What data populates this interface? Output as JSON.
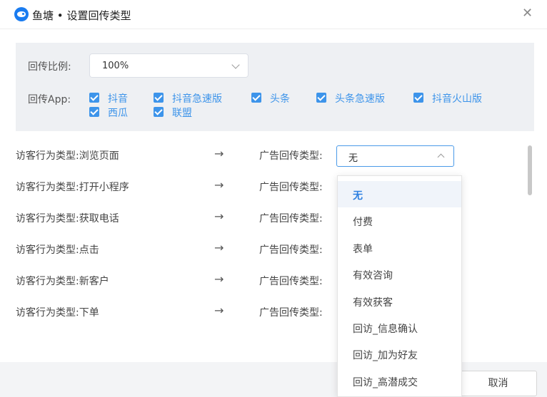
{
  "dialog": {
    "app_name": "鱼塘",
    "separator": "•",
    "title": "设置回传类型"
  },
  "config": {
    "ratio_label": "回传比例:",
    "ratio_value": "100%",
    "app_label": "回传App:",
    "apps": [
      {
        "label": "抖音",
        "checked": true
      },
      {
        "label": "抖音急速版",
        "checked": true
      },
      {
        "label": "头条",
        "checked": true
      },
      {
        "label": "头条急速版",
        "checked": true
      },
      {
        "label": "抖音火山版",
        "checked": true
      },
      {
        "label": "西瓜",
        "checked": true
      },
      {
        "label": "联盟",
        "checked": true
      }
    ]
  },
  "mappings": [
    {
      "visitor": "访客行为类型:浏览页面",
      "ad": "广告回传类型:",
      "selected": "无"
    },
    {
      "visitor": "访客行为类型:打开小程序",
      "ad": "广告回传类型:"
    },
    {
      "visitor": "访客行为类型:获取电话",
      "ad": "广告回传类型:"
    },
    {
      "visitor": "访客行为类型:点击",
      "ad": "广告回传类型:"
    },
    {
      "visitor": "访客行为类型:新客户",
      "ad": "广告回传类型:"
    },
    {
      "visitor": "访客行为类型:下单",
      "ad": "广告回传类型:"
    }
  ],
  "arrow_glyph": "→",
  "dropdown": {
    "options": [
      "无",
      "付费",
      "表单",
      "有效咨询",
      "有效获客",
      "回访_信息确认",
      "回访_加为好友",
      "回访_高潜成交"
    ],
    "selected_index": 0
  },
  "footer": {
    "cancel_label": "取消"
  },
  "colors": {
    "accent": "#2c7fe0",
    "checkbox": "#3d94ea",
    "panel_bg": "#eef0f3"
  },
  "icons": {
    "logo": "fish-logo-icon",
    "close": "close-icon"
  }
}
